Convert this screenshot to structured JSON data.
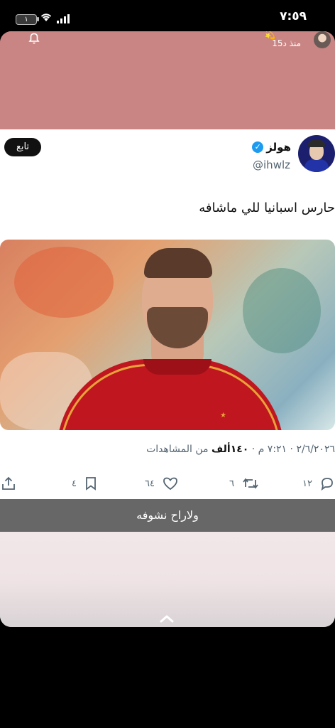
{
  "status_bar": {
    "time": "٧:٥٩",
    "battery_level": "١"
  },
  "story_header": {
    "time_ago": "منذ د15"
  },
  "tweet": {
    "follow_label": "تابع",
    "display_name": "هولز",
    "handle": "@ihwlz",
    "text": "حارس اسبانيا للي ماشافه",
    "meta_prefix": "٢/٦/٢٠٢٦ · ٧:٢١ م · ",
    "views_count": "١٤٠ألف",
    "views_label": " من المشاهدات",
    "replies": "١٢",
    "retweets": "٦",
    "likes": "٦٤",
    "bookmarks": "٤"
  },
  "caption": {
    "text": "ولاراح نشوفه"
  },
  "colors": {
    "story_header_bg": "#c98584",
    "verified_blue": "#1d9bf0",
    "jersey_red": "#c0161f"
  },
  "icons": [
    "bell-icon",
    "verified-badge-icon",
    "reply-icon",
    "retweet-icon",
    "like-icon",
    "bookmark-icon",
    "share-icon",
    "chevron-up-icon",
    "wifi-icon",
    "signal-icon",
    "battery-icon"
  ]
}
